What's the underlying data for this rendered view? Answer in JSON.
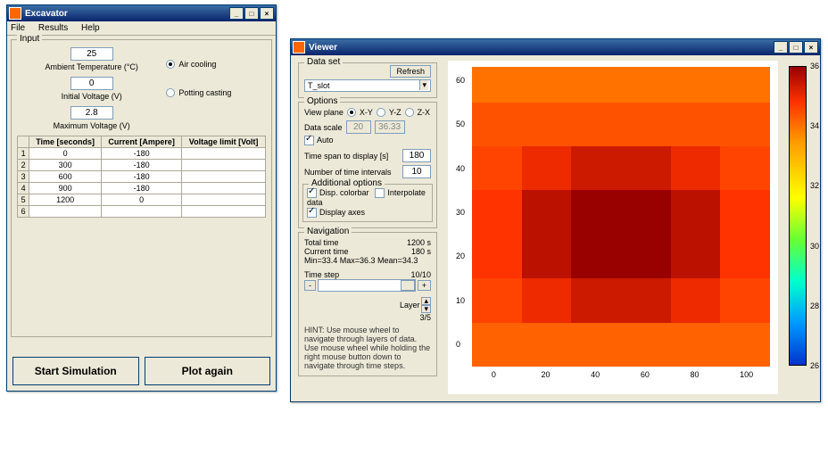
{
  "win1": {
    "title": "Excavator",
    "menu": [
      "File",
      "Results",
      "Help"
    ],
    "input_legend": "Input",
    "temp_value": "25",
    "temp_label": "Ambient Temperature (°C)",
    "volt_value": "0",
    "volt_label": "Initial Voltage (V)",
    "maxv_value": "2.8",
    "maxv_label": "Maximum Voltage (V)",
    "radio_air": "Air cooling",
    "radio_potting": "Potting casting",
    "table": {
      "headers": [
        "",
        "Time [seconds]",
        "Current [Ampere]",
        "Voltage limit [Volt]"
      ],
      "rows": [
        [
          "1",
          "0",
          "-180",
          ""
        ],
        [
          "2",
          "300",
          "-180",
          ""
        ],
        [
          "3",
          "600",
          "-180",
          ""
        ],
        [
          "4",
          "900",
          "-180",
          ""
        ],
        [
          "5",
          "1200",
          "0",
          ""
        ],
        [
          "6",
          "",
          "",
          ""
        ]
      ]
    },
    "btn_start": "Start Simulation",
    "btn_plot": "Plot again"
  },
  "win2": {
    "title": "Viewer",
    "dataset_legend": "Data set",
    "btn_refresh": "Refresh",
    "dataset_sel": "T_slot",
    "options_legend": "Options",
    "viewplane_label": "View plane",
    "vp_xy": "X-Y",
    "vp_yz": "Y-Z",
    "vp_zx": "Z-X",
    "datascale_label": "Data scale",
    "datascale_lo": "20",
    "datascale_hi": "36.33",
    "auto_label": "Auto",
    "timespan_label": "Time span to display [s]",
    "timespan_val": "180",
    "numint_label": "Number of time intervals",
    "numint_val": "10",
    "addopt_legend": "Additional options",
    "dispcb_label": "Disp. colorbar",
    "interp_label": "Interpolate data",
    "dispaxes_label": "Display axes",
    "nav_legend": "Navigation",
    "totaltime_label": "Total time",
    "totaltime_val": "1200 s",
    "curtime_label": "Current time",
    "curtime_val": "180 s",
    "stats": "Min=33.4  Max=36.3  Mean=34.3",
    "timestep_label": "Time step",
    "timestep_val": "10/10",
    "layer_label": "Layer",
    "layer_val": "3/5",
    "hint": "HINT: Use mouse wheel to navigate through layers of data. Use mouse wheel while holding the right mouse button down to navigate through time steps.",
    "slider_plus": "+",
    "slider_minus": "-",
    "spin_up": "▴",
    "spin_dn": "▾"
  },
  "chart_data": {
    "type": "heatmap",
    "title": "",
    "xlabel": "",
    "ylabel": "",
    "x_ticks": [
      0,
      20,
      40,
      60,
      80,
      100
    ],
    "y_ticks": [
      0,
      10,
      20,
      30,
      40,
      50,
      60
    ],
    "colorbar_ticks": [
      26,
      28,
      30,
      32,
      34,
      36
    ],
    "x_edges": [
      -10,
      10,
      30,
      50,
      70,
      90,
      110
    ],
    "y_edges": [
      -5,
      5,
      15,
      25,
      35,
      45,
      55,
      63
    ],
    "values": [
      [
        34.2,
        34.2,
        34.2,
        34.2,
        34.2,
        34.2
      ],
      [
        34.6,
        35.0,
        35.4,
        35.4,
        35.0,
        34.6
      ],
      [
        34.8,
        35.6,
        36.1,
        36.3,
        35.6,
        34.8
      ],
      [
        34.8,
        35.6,
        36.1,
        36.1,
        35.6,
        34.8
      ],
      [
        34.6,
        35.0,
        35.4,
        35.4,
        35.0,
        34.6
      ],
      [
        34.4,
        34.4,
        34.4,
        34.4,
        34.4,
        34.4
      ],
      [
        34.0,
        34.0,
        34.0,
        34.0,
        34.0,
        34.0
      ]
    ],
    "value_range": [
      33.4,
      36.3
    ]
  }
}
